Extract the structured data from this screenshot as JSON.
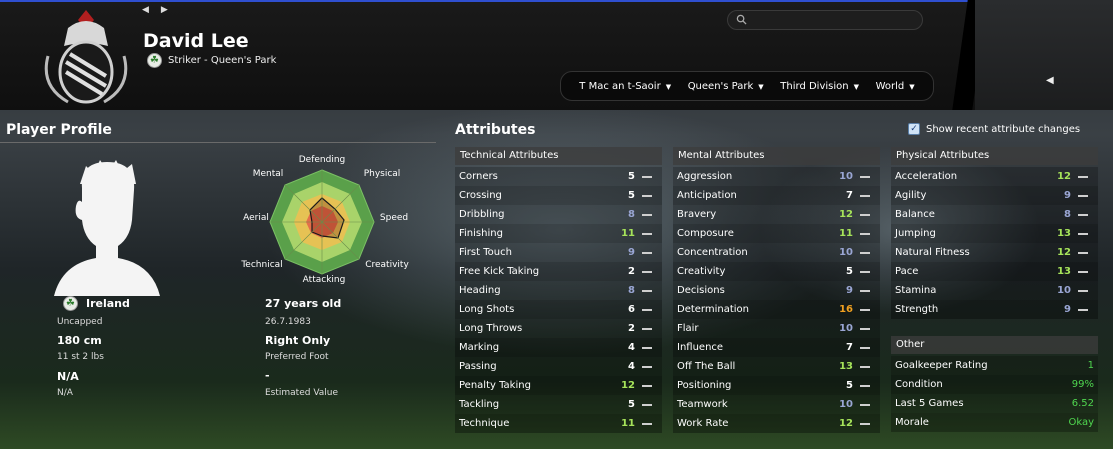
{
  "colors": {
    "val_high": "#a6e35a",
    "val_mid": "#ffffff",
    "val_low": "#9aa6d4",
    "val_orange": "#f0a020",
    "accent_green": "#4fd64f"
  },
  "header": {
    "player_name": "David Lee",
    "subtitle": "Striker - Queen's Park",
    "search_placeholder": "",
    "breadcrumbs": [
      {
        "label": "T Mac an t-Saoir"
      },
      {
        "label": "Queen's Park"
      },
      {
        "label": "Third Division"
      },
      {
        "label": "World"
      }
    ]
  },
  "profile": {
    "title": "Player Profile",
    "nation": "Ireland",
    "caps": "Uncapped",
    "height": "180 cm",
    "weight": "11 st 2 lbs",
    "value_main": "N/A",
    "value_sub": "N/A",
    "age": "27 years old",
    "dob": "26.7.1983",
    "foot": "Right Only",
    "foot_label": "Preferred Foot",
    "est_value": "-",
    "est_value_label": "Estimated Value",
    "radar_labels": {
      "defending": "Defending",
      "physical": "Physical",
      "speed": "Speed",
      "creativity": "Creativity",
      "attacking": "Attacking",
      "technical": "Technical",
      "aerial": "Aerial",
      "mental": "Mental"
    }
  },
  "attributes": {
    "title": "Attributes",
    "show_changes_label": "Show recent attribute changes",
    "technical": {
      "header": "Technical Attributes",
      "rows": [
        {
          "name": "Corners",
          "value": "5",
          "tier": "mid"
        },
        {
          "name": "Crossing",
          "value": "5",
          "tier": "mid"
        },
        {
          "name": "Dribbling",
          "value": "8",
          "tier": "low"
        },
        {
          "name": "Finishing",
          "value": "11",
          "tier": "high"
        },
        {
          "name": "First Touch",
          "value": "9",
          "tier": "low"
        },
        {
          "name": "Free Kick Taking",
          "value": "2",
          "tier": "mid"
        },
        {
          "name": "Heading",
          "value": "8",
          "tier": "low"
        },
        {
          "name": "Long Shots",
          "value": "6",
          "tier": "mid"
        },
        {
          "name": "Long Throws",
          "value": "2",
          "tier": "mid"
        },
        {
          "name": "Marking",
          "value": "4",
          "tier": "mid"
        },
        {
          "name": "Passing",
          "value": "4",
          "tier": "mid"
        },
        {
          "name": "Penalty Taking",
          "value": "12",
          "tier": "high"
        },
        {
          "name": "Tackling",
          "value": "5",
          "tier": "mid"
        },
        {
          "name": "Technique",
          "value": "11",
          "tier": "high"
        }
      ]
    },
    "mental": {
      "header": "Mental Attributes",
      "rows": [
        {
          "name": "Aggression",
          "value": "10",
          "tier": "low"
        },
        {
          "name": "Anticipation",
          "value": "7",
          "tier": "mid"
        },
        {
          "name": "Bravery",
          "value": "12",
          "tier": "high"
        },
        {
          "name": "Composure",
          "value": "11",
          "tier": "high"
        },
        {
          "name": "Concentration",
          "value": "10",
          "tier": "low"
        },
        {
          "name": "Creativity",
          "value": "5",
          "tier": "mid"
        },
        {
          "name": "Decisions",
          "value": "9",
          "tier": "low"
        },
        {
          "name": "Determination",
          "value": "16",
          "tier": "orange"
        },
        {
          "name": "Flair",
          "value": "10",
          "tier": "low"
        },
        {
          "name": "Influence",
          "value": "7",
          "tier": "mid"
        },
        {
          "name": "Off The Ball",
          "value": "13",
          "tier": "high"
        },
        {
          "name": "Positioning",
          "value": "5",
          "tier": "mid"
        },
        {
          "name": "Teamwork",
          "value": "10",
          "tier": "low"
        },
        {
          "name": "Work Rate",
          "value": "12",
          "tier": "high"
        }
      ]
    },
    "physical": {
      "header": "Physical Attributes",
      "rows": [
        {
          "name": "Acceleration",
          "value": "12",
          "tier": "high"
        },
        {
          "name": "Agility",
          "value": "9",
          "tier": "low"
        },
        {
          "name": "Balance",
          "value": "8",
          "tier": "low"
        },
        {
          "name": "Jumping",
          "value": "13",
          "tier": "high"
        },
        {
          "name": "Natural Fitness",
          "value": "12",
          "tier": "high"
        },
        {
          "name": "Pace",
          "value": "13",
          "tier": "high"
        },
        {
          "name": "Stamina",
          "value": "10",
          "tier": "low"
        },
        {
          "name": "Strength",
          "value": "9",
          "tier": "low"
        }
      ]
    },
    "other": {
      "header": "Other",
      "rows": [
        {
          "name": "Goalkeeper Rating",
          "value": "1"
        },
        {
          "name": "Condition",
          "value": "99%"
        },
        {
          "name": "Last 5 Games",
          "value": "6.52"
        },
        {
          "name": "Morale",
          "value": "Okay"
        }
      ]
    }
  }
}
